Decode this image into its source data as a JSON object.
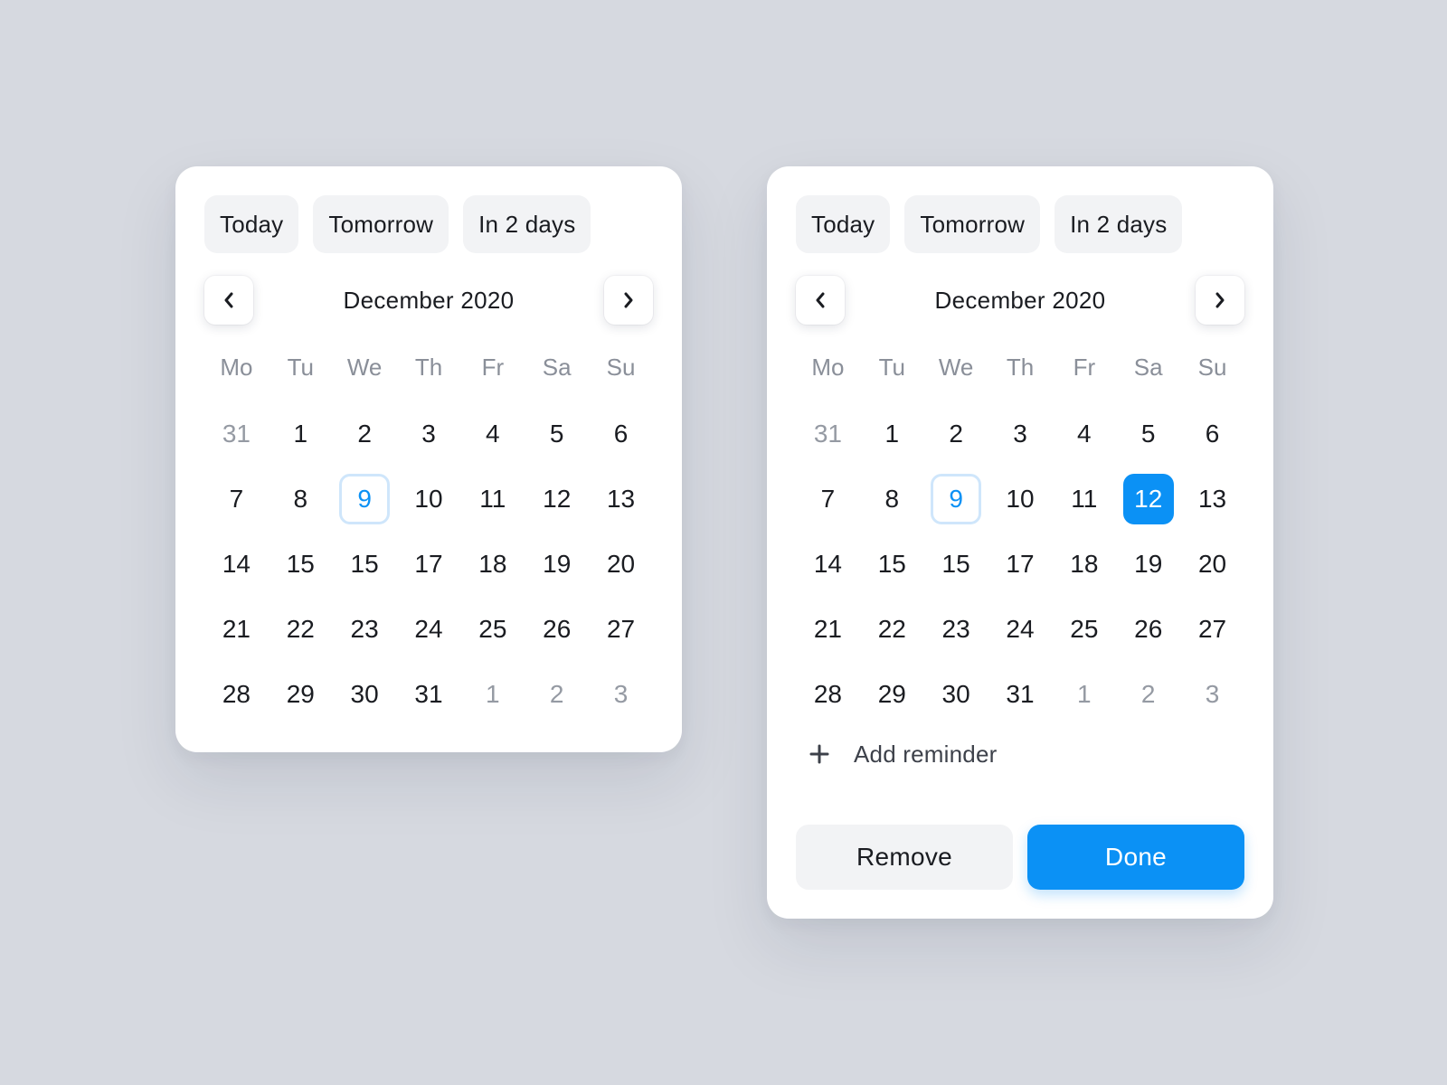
{
  "colors": {
    "background": "#d6d9e0",
    "accent": "#0b91f5",
    "today_outline": "#cfe6fb",
    "chip_background": "#f2f3f5",
    "muted_text": "#959aa3"
  },
  "pickers": [
    {
      "quick_options": [
        "Today",
        "Tomorrow",
        "In 2 days"
      ],
      "month_label": "December 2020",
      "prev_icon": "chevron-left-icon",
      "next_icon": "chevron-right-icon",
      "weekdays": [
        "Mo",
        "Tu",
        "We",
        "Th",
        "Fr",
        "Sa",
        "Su"
      ],
      "days": [
        {
          "label": "31",
          "muted": true
        },
        {
          "label": "1"
        },
        {
          "label": "2"
        },
        {
          "label": "3"
        },
        {
          "label": "4"
        },
        {
          "label": "5"
        },
        {
          "label": "6"
        },
        {
          "label": "7"
        },
        {
          "label": "8"
        },
        {
          "label": "9",
          "today": true
        },
        {
          "label": "10"
        },
        {
          "label": "11"
        },
        {
          "label": "12"
        },
        {
          "label": "13"
        },
        {
          "label": "14"
        },
        {
          "label": "15"
        },
        {
          "label": "15"
        },
        {
          "label": "17"
        },
        {
          "label": "18"
        },
        {
          "label": "19"
        },
        {
          "label": "20"
        },
        {
          "label": "21"
        },
        {
          "label": "22"
        },
        {
          "label": "23"
        },
        {
          "label": "24"
        },
        {
          "label": "25"
        },
        {
          "label": "26"
        },
        {
          "label": "27"
        },
        {
          "label": "28"
        },
        {
          "label": "29"
        },
        {
          "label": "30"
        },
        {
          "label": "31"
        },
        {
          "label": "1",
          "muted": true
        },
        {
          "label": "2",
          "muted": true
        },
        {
          "label": "3",
          "muted": true
        }
      ]
    },
    {
      "quick_options": [
        "Today",
        "Tomorrow",
        "In 2 days"
      ],
      "month_label": "December 2020",
      "prev_icon": "chevron-left-icon",
      "next_icon": "chevron-right-icon",
      "weekdays": [
        "Mo",
        "Tu",
        "We",
        "Th",
        "Fr",
        "Sa",
        "Su"
      ],
      "days": [
        {
          "label": "31",
          "muted": true
        },
        {
          "label": "1"
        },
        {
          "label": "2"
        },
        {
          "label": "3"
        },
        {
          "label": "4"
        },
        {
          "label": "5"
        },
        {
          "label": "6"
        },
        {
          "label": "7"
        },
        {
          "label": "8"
        },
        {
          "label": "9",
          "today": true
        },
        {
          "label": "10"
        },
        {
          "label": "11"
        },
        {
          "label": "12",
          "selected": true
        },
        {
          "label": "13"
        },
        {
          "label": "14"
        },
        {
          "label": "15"
        },
        {
          "label": "15"
        },
        {
          "label": "17"
        },
        {
          "label": "18"
        },
        {
          "label": "19"
        },
        {
          "label": "20"
        },
        {
          "label": "21"
        },
        {
          "label": "22"
        },
        {
          "label": "23"
        },
        {
          "label": "24"
        },
        {
          "label": "25"
        },
        {
          "label": "26"
        },
        {
          "label": "27"
        },
        {
          "label": "28"
        },
        {
          "label": "29"
        },
        {
          "label": "30"
        },
        {
          "label": "31"
        },
        {
          "label": "1",
          "muted": true
        },
        {
          "label": "2",
          "muted": true
        },
        {
          "label": "3",
          "muted": true
        }
      ],
      "reminder": {
        "icon": "plus-icon",
        "label": "Add reminder"
      },
      "actions": {
        "remove_label": "Remove",
        "done_label": "Done"
      }
    }
  ]
}
